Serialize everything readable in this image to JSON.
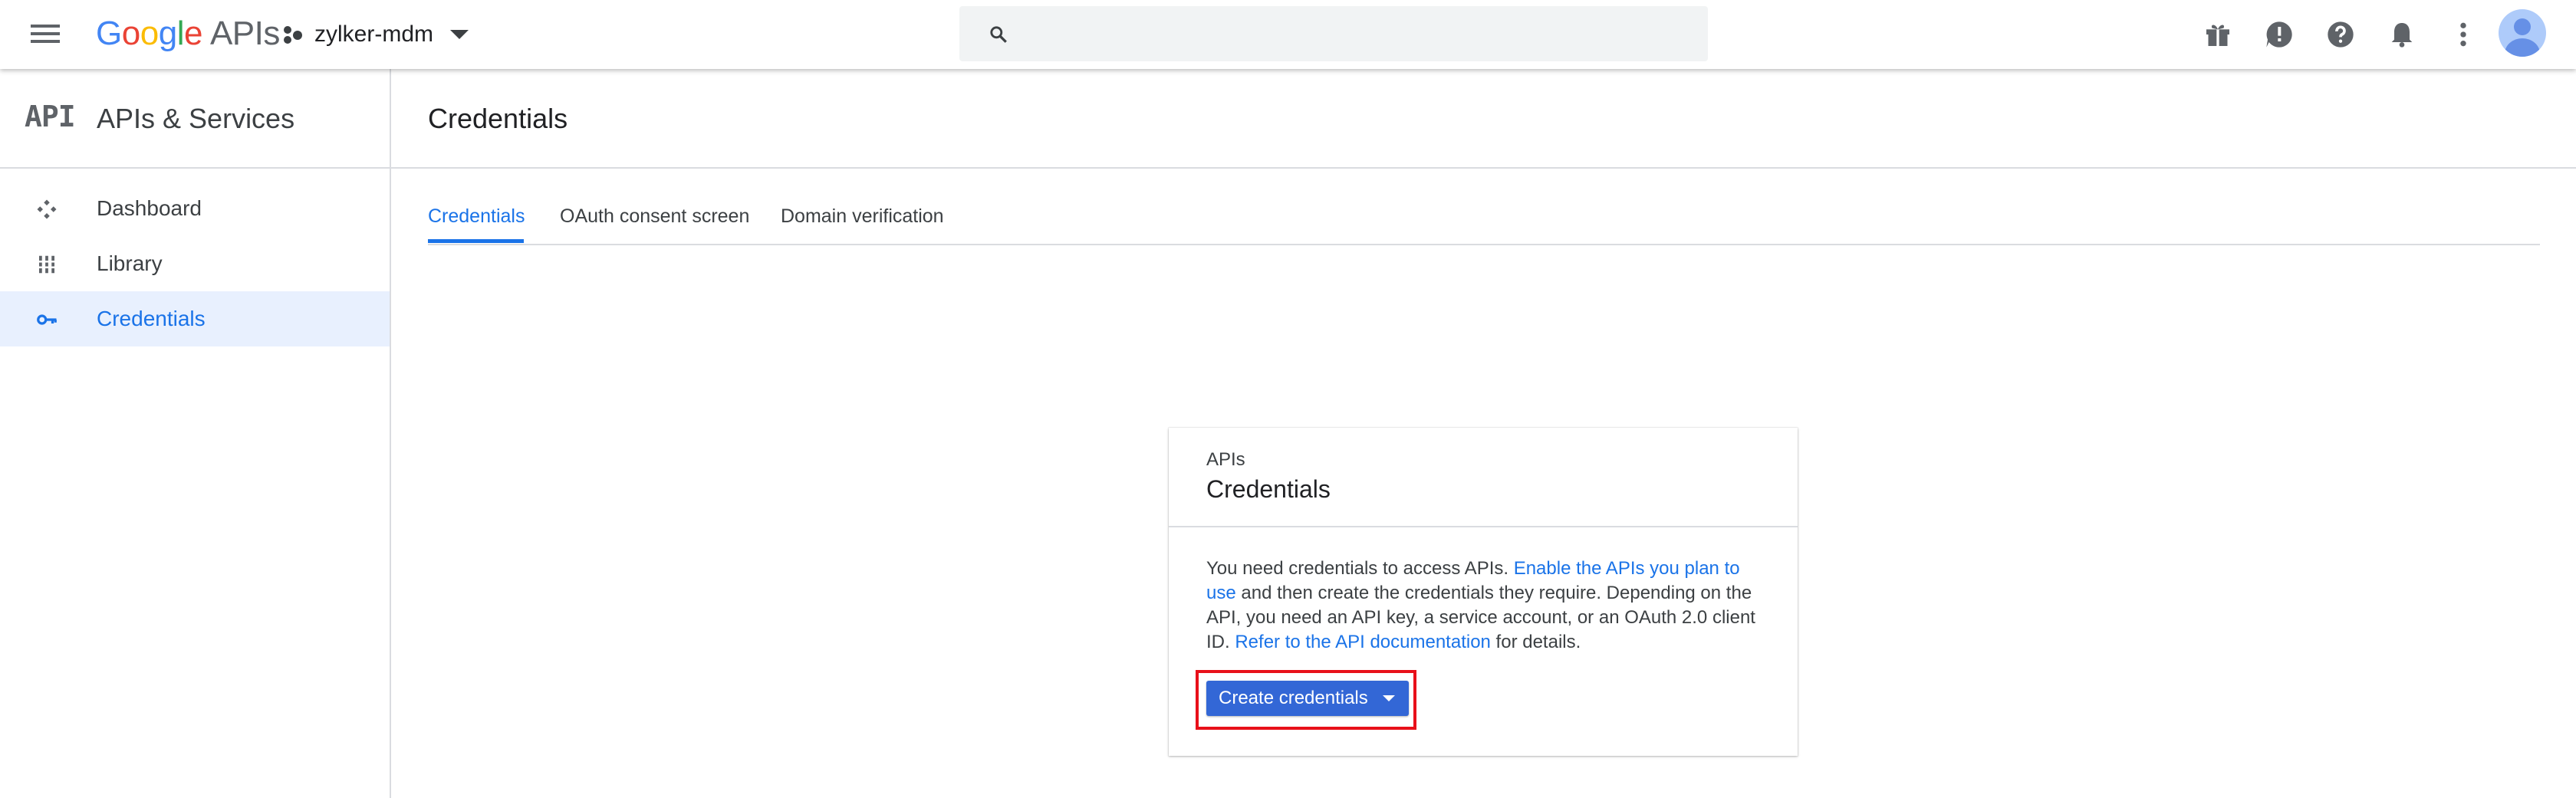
{
  "header": {
    "brand": {
      "google": "Google",
      "product": "APIs"
    },
    "project_name": "zylker-mdm",
    "search": {
      "value": "",
      "placeholder": ""
    },
    "icons": [
      "gift-icon",
      "feedback-icon",
      "help-icon",
      "notifications-icon",
      "more-vert-icon",
      "account-avatar"
    ]
  },
  "sidebar": {
    "logo_text": "API",
    "title": "APIs & Services",
    "items": [
      {
        "label": "Dashboard",
        "icon": "dashboard-icon"
      },
      {
        "label": "Library",
        "icon": "library-icon"
      },
      {
        "label": "Credentials",
        "icon": "key-icon",
        "active": true
      }
    ]
  },
  "main": {
    "title": "Credentials",
    "tabs": [
      {
        "label": "Credentials",
        "active": true
      },
      {
        "label": "OAuth consent screen"
      },
      {
        "label": "Domain verification"
      }
    ]
  },
  "card": {
    "kicker": "APIs",
    "title": "Credentials",
    "body_1": "You need credentials to access APIs. ",
    "link_1": "Enable the APIs you plan to use",
    "body_2": " and then create the credentials they require. Depending on the API, you need an API key, a service account, or an OAuth 2.0 client ID. ",
    "link_2": "Refer to the API documentation",
    "body_3": " for details.",
    "button_label": "Create credentials"
  },
  "colors": {
    "accent": "#1a73e8",
    "button": "#3367d6",
    "highlight": "#e8101a"
  }
}
